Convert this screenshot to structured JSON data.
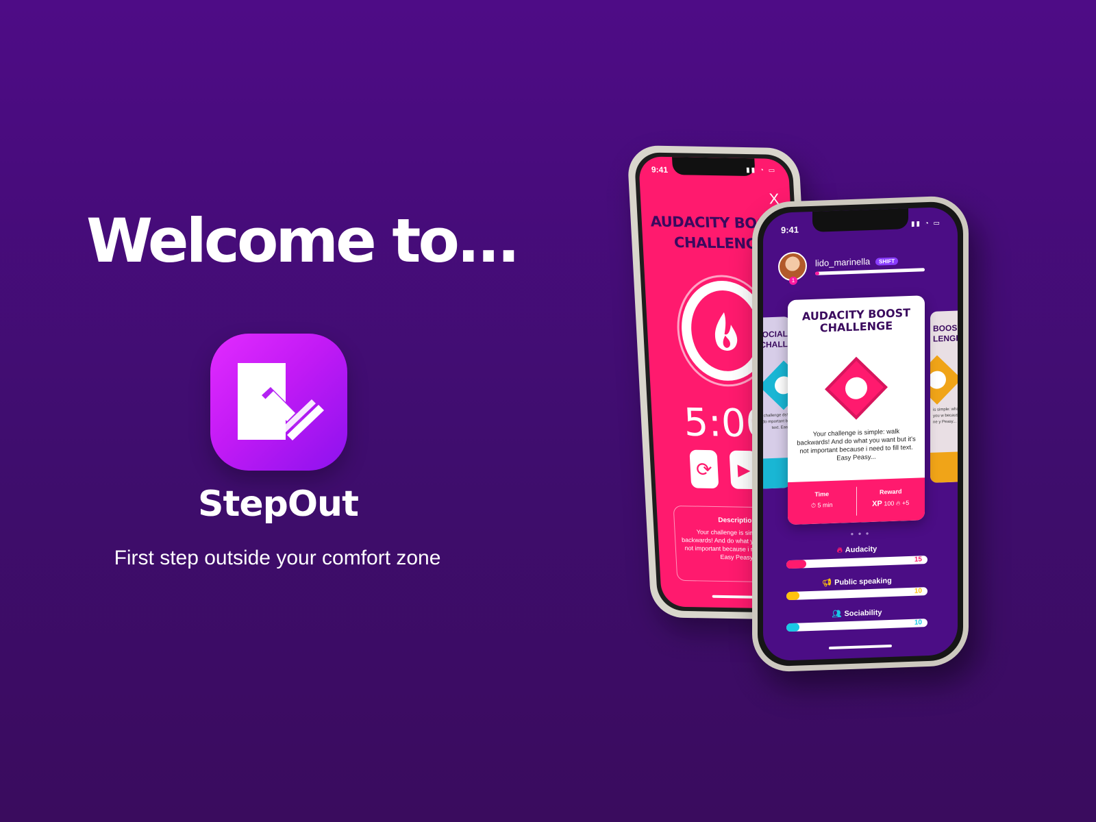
{
  "hero": {
    "welcome": "Welcome to...",
    "brand": "StepOut",
    "tagline": "First step outside your comfort zone"
  },
  "timer_screen": {
    "status_time": "9:41",
    "close": "X",
    "title": "AUDACITY BOOST\nCHALLENGE",
    "timer": "5:00",
    "description_title": "Description",
    "description_text": "Your challenge is simple: walk backwards! And do what you want but it's not important because i need to fill text. Easy Peasy..."
  },
  "profile_screen": {
    "status_time": "9:41",
    "username": "lido_marinella",
    "badge": "SHIFT",
    "level": "1",
    "xp_progress": 0.04,
    "left_card_title": "OCIAL\nCHALL",
    "left_card_text": "r challenge ds! And do mportant b text. Eas",
    "right_card_title": "BOOS\nLENGE",
    "right_card_text": "is simple: what you w because i ne y Peasy...",
    "card": {
      "title": "AUDACITY BOOST\nCHALLENGE",
      "text": "Your challenge is simple: walk backwards! And do what you want but it's not important because i need to fill text. Easy Peasy...",
      "time_label": "Time",
      "time_value": "5 min",
      "reward_label": "Reward",
      "reward_xp_prefix": "XP",
      "reward_xp": "100",
      "reward_flame": "+5"
    },
    "stats": [
      {
        "label": "Audacity",
        "value": "15",
        "progress": 0.14,
        "color": "#ff1a6e"
      },
      {
        "label": "Public speaking",
        "value": "10",
        "progress": 0.09,
        "color": "#ffc20e"
      },
      {
        "label": "Sociability",
        "value": "10",
        "progress": 0.09,
        "color": "#19c8e6"
      }
    ]
  }
}
